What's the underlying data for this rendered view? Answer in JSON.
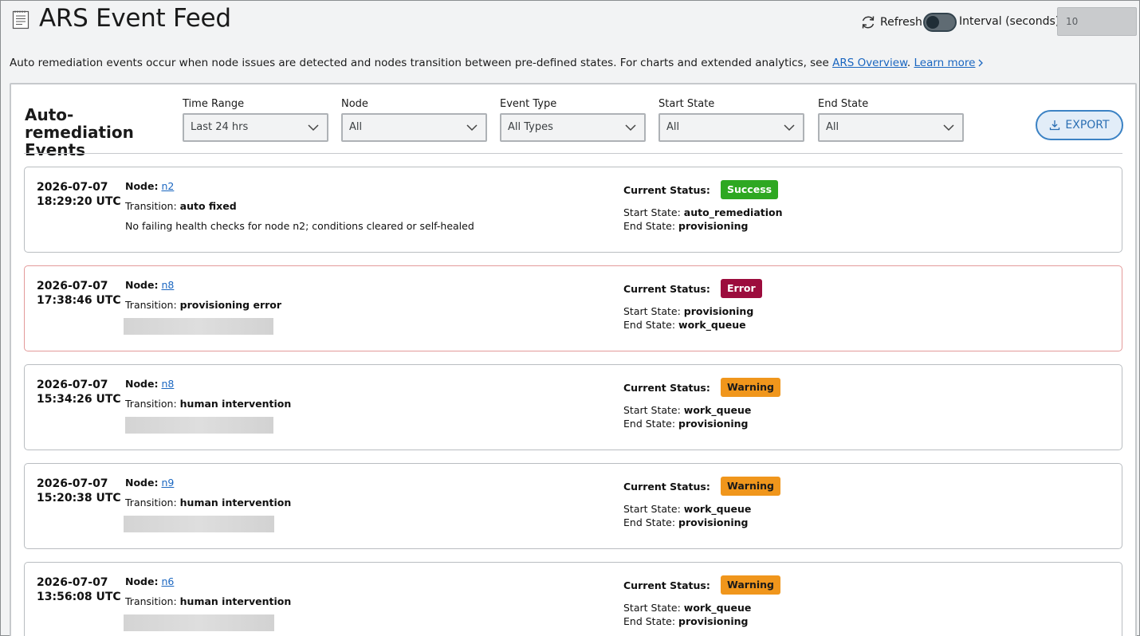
{
  "header": {
    "title": "ARS Event Feed",
    "refresh_label": "Refresh",
    "interval_label": "Interval (seconds):",
    "interval_value": "10",
    "auto_refresh_on": false
  },
  "description": {
    "text": "Auto remediation events occur when node issues are detected and nodes transition between pre-defined states. For charts and extended analytics, see ",
    "overview_link": "ARS Overview",
    "separator": ".",
    "learn_more_link": "Learn more"
  },
  "panel": {
    "title": "Auto-remediation Events",
    "export_label": "EXPORT",
    "filters": [
      {
        "label": "Time Range",
        "value": "Last 24 hrs"
      },
      {
        "label": "Node",
        "value": "All"
      },
      {
        "label": "Event Type",
        "value": "All Types"
      },
      {
        "label": "Start State",
        "value": "All"
      },
      {
        "label": "End State",
        "value": "All"
      }
    ]
  },
  "labels": {
    "node": "Node:",
    "transition": "Transition:",
    "current_status": "Current Status:",
    "start_state": "Start State:",
    "end_state": "End State:"
  },
  "colors": {
    "success": "#2ea822",
    "error": "#9c0c3d",
    "warning": "#f0961c",
    "link": "#1a66c0"
  },
  "events": [
    {
      "date": "2026-07-07",
      "time": "18:29:20 UTC",
      "node": "n2",
      "transition": "auto fixed",
      "detail": "No failing health checks for node n2; conditions cleared or self-healed",
      "status": "Success",
      "start_state": "auto_remediation",
      "end_state": "provisioning"
    },
    {
      "date": "2026-07-07",
      "time": "17:38:46 UTC",
      "node": "n8",
      "transition": "provisioning error",
      "detail": "",
      "status": "Error",
      "start_state": "provisioning",
      "end_state": "work_queue"
    },
    {
      "date": "2026-07-07",
      "time": "15:34:26 UTC",
      "node": "n8",
      "transition": "human intervention",
      "detail": "",
      "status": "Warning",
      "start_state": "work_queue",
      "end_state": "provisioning"
    },
    {
      "date": "2026-07-07",
      "time": "15:20:38 UTC",
      "node": "n9",
      "transition": "human intervention",
      "detail": "",
      "status": "Warning",
      "start_state": "work_queue",
      "end_state": "provisioning"
    },
    {
      "date": "2026-07-07",
      "time": "13:56:08 UTC",
      "node": "n6",
      "transition": "human intervention",
      "detail": "",
      "status": "Warning",
      "start_state": "work_queue",
      "end_state": "provisioning"
    }
  ]
}
